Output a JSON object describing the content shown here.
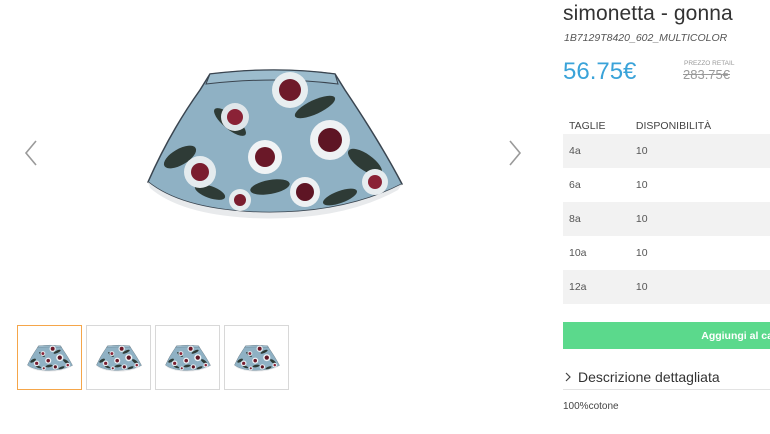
{
  "product": {
    "title": "simonetta - gonna",
    "sku": "1B7129T8420_602_MULTICOLOR",
    "price": "56.75€",
    "retail_label": "PREZZO RETAIL",
    "retail_price": "283.75€",
    "accent_color": "#3aa3d9"
  },
  "sizes": {
    "headers": [
      "TAGLIE",
      "DISPONIBILITÀ"
    ],
    "rows": [
      {
        "size": "4a",
        "availability": "10"
      },
      {
        "size": "6a",
        "availability": "10"
      },
      {
        "size": "8a",
        "availability": "10"
      },
      {
        "size": "10a",
        "availability": "10"
      },
      {
        "size": "12a",
        "availability": "10"
      }
    ]
  },
  "cart": {
    "button_label": "Aggiungi al ca",
    "button_color": "#5bd98c"
  },
  "description": {
    "toggle_label": "Descrizione dettagliata",
    "text": "100%cotone"
  },
  "gallery": {
    "prev_icon": "chevron-left-icon",
    "next_icon": "chevron-right-icon",
    "thumbnail_count": 4,
    "active_thumbnail_color": "#f5a64a"
  }
}
